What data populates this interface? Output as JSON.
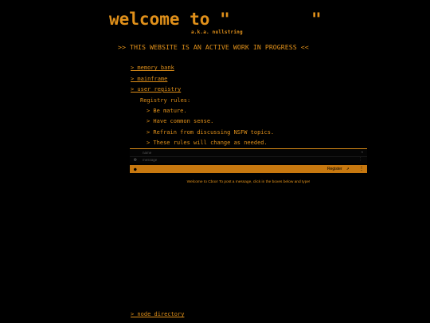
{
  "header": {
    "title": "welcome to \"",
    "title_close_quote": "\"",
    "aka": "a.k.a. nullstring",
    "banner": ">> THIS WEBSITE IS AN ACTIVE WORK IN PROGRESS <<"
  },
  "nav": {
    "memory_bank": "> memory bank",
    "mainframe": "> mainframe",
    "user_registry": "> user registry",
    "node_directory": "> node directory"
  },
  "registry": {
    "title": "Registry rules:",
    "rules": [
      "> Be mature.",
      "> Have common sense.",
      "> Refrain from discussing NSFW topics.",
      "> These rules will change as needed."
    ]
  },
  "chat": {
    "name_placeholder": "name",
    "message_placeholder": "message",
    "register_label": "Register",
    "welcome_text": "Welcome to Cbox! To post a message, click in the boxes below and type!",
    "accent_color": "#c7780f",
    "icons": [
      "gear-icon",
      "user-icon",
      "external-link-icon"
    ]
  },
  "colors": {
    "background": "#000000",
    "text": "#e0901a"
  }
}
